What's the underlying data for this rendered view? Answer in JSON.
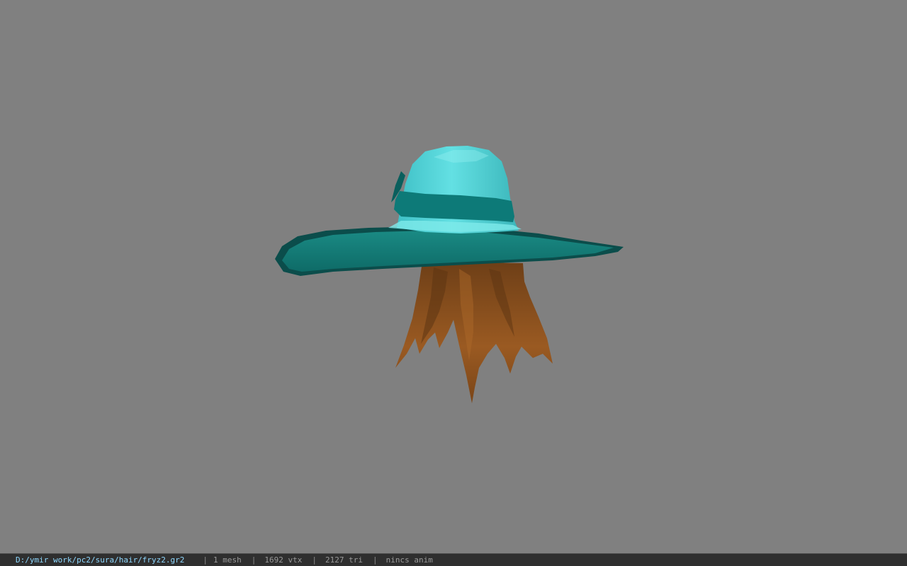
{
  "viewer": {
    "background_color": "#808080",
    "model": {
      "hat_crown_color": "#4fd2d6",
      "hat_band_color": "#0d7a78",
      "hat_brim_color": "#137d78",
      "hair_color": "#8a4f1c"
    }
  },
  "status_bar": {
    "file_path": "D:/ymir work/pc2/sura/hair/fryz2.gr2",
    "separator": "|",
    "mesh_count": "1 mesh",
    "vertex_count": "1692 vtx",
    "triangle_count": "2127 tri",
    "animation_status": "nincs anim"
  }
}
